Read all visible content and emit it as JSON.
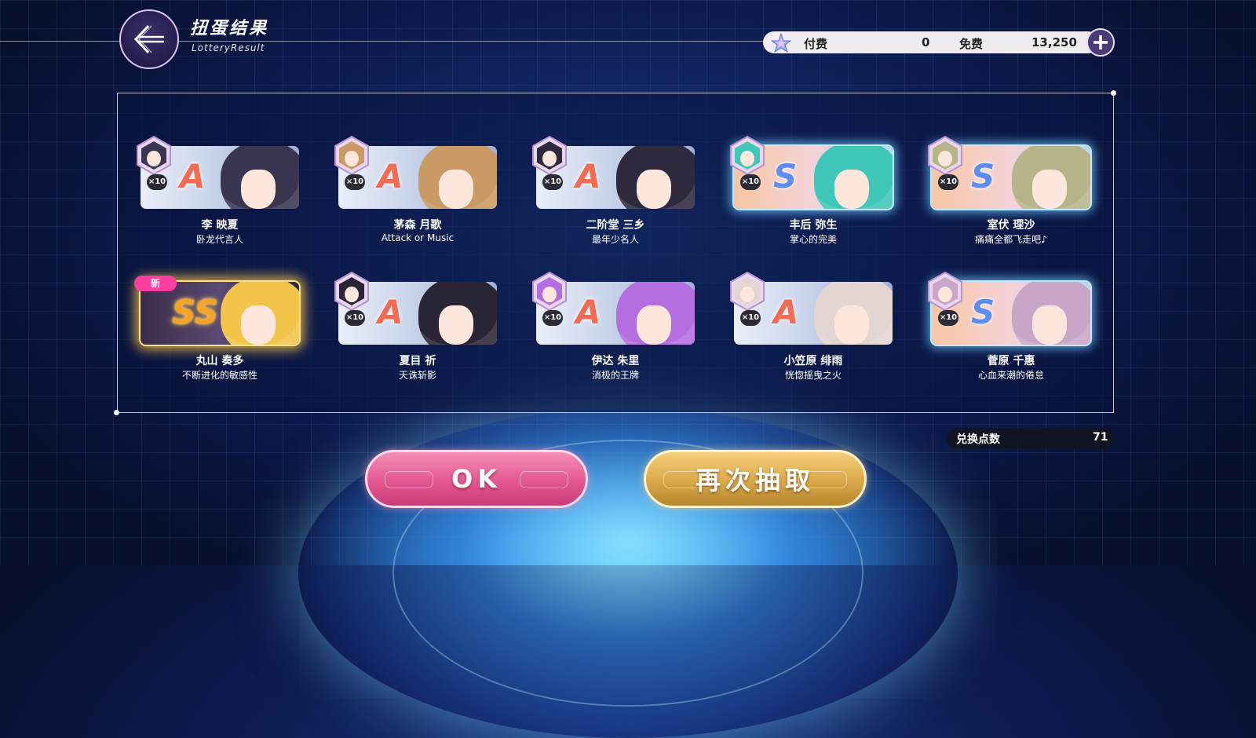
{
  "header": {
    "title": "扭蛋结果",
    "subtitle": "LotteryResult"
  },
  "currency": {
    "paid_label": "付费",
    "paid_value": "0",
    "free_label": "免费",
    "free_value": "13,250"
  },
  "results": [
    {
      "name": "李 映夏",
      "title": "卧龙代言人",
      "rank": "A",
      "dupe": "×10",
      "new": false,
      "hair": "#3a3550"
    },
    {
      "name": "茅森 月歌",
      "title": "Attack or Music",
      "rank": "A",
      "dupe": "×10",
      "new": false,
      "hair": "#c99a64"
    },
    {
      "name": "二阶堂 三乡",
      "title": "最年少名人",
      "rank": "A",
      "dupe": "×10",
      "new": false,
      "hair": "#2e2a3d"
    },
    {
      "name": "丰后 弥生",
      "title": "掌心的完美",
      "rank": "S",
      "dupe": "×10",
      "new": false,
      "hair": "#3fc7b8"
    },
    {
      "name": "室伏 理沙",
      "title": "痛痛全都飞走吧♪",
      "rank": "S",
      "dupe": "×10",
      "new": false,
      "hair": "#b8b48a"
    },
    {
      "name": "丸山 奏多",
      "title": "不断进化的敏感性",
      "rank": "SS",
      "dupe": "",
      "new": true,
      "new_label": "新",
      "hair": "#f2c44a"
    },
    {
      "name": "夏目 祈",
      "title": "天诛斩影",
      "rank": "A",
      "dupe": "×10",
      "new": false,
      "hair": "#2a2535"
    },
    {
      "name": "伊达 朱里",
      "title": "消极的王牌",
      "rank": "A",
      "dupe": "×10",
      "new": false,
      "hair": "#b46ee0"
    },
    {
      "name": "小笠原 绯雨",
      "title": "恍惚摇曳之火",
      "rank": "A",
      "dupe": "×10",
      "new": false,
      "hair": "#e3d6d2"
    },
    {
      "name": "菅原 千惠",
      "title": "心血来潮的倦怠",
      "rank": "S",
      "dupe": "×10",
      "new": false,
      "hair": "#c9a6c8"
    }
  ],
  "exchange": {
    "label": "兑换点数",
    "value": "71"
  },
  "buttons": {
    "ok": "OK",
    "redraw": "再次抽取"
  },
  "colors": {
    "rank_a": "#f26b52",
    "rank_s": "#5e8df0",
    "rank_ss": "#f7a323",
    "ok_button": "#e2578f",
    "redraw_button": "#d9a84a",
    "new_badge": "#ff3fa0"
  }
}
